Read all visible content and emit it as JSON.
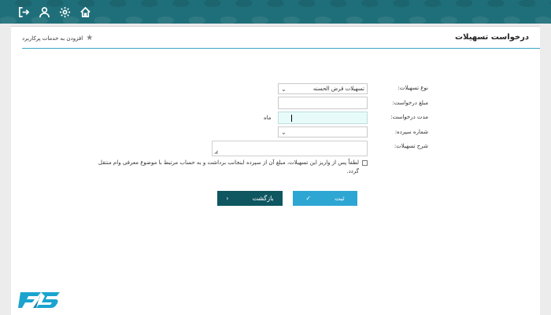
{
  "header": {
    "icons": [
      "home-icon",
      "gear-icon",
      "user-icon",
      "logout-icon"
    ]
  },
  "page": {
    "title": "درخواست تسهیلات",
    "add_to_services": "افزودن به خدمات پرکاربرد"
  },
  "form": {
    "loan_type": {
      "label": "نوع تسهیلات:",
      "value": "تسهیلات قرض الحسنه"
    },
    "amount": {
      "label": "مبلغ درخواست:",
      "value": ""
    },
    "duration": {
      "label": "مدت درخواست:",
      "value": "",
      "unit": "ماه"
    },
    "deposit_number": {
      "label": "شماره سپرده:",
      "value": ""
    },
    "description": {
      "label": "شرح تسهیلات:",
      "value": ""
    },
    "agreement": {
      "checked": false,
      "text_line1": "لطفاً پس از واریز این تسهیلات، مبلغ آن از سپرده اینجانب برداشت و به حساب مرتبط با موضوع معرفی وام منتقل",
      "text_line2": "گردد."
    }
  },
  "buttons": {
    "submit": "ثبت",
    "back": "بازگشت"
  },
  "colors": {
    "header": "#1f6f7a",
    "accent": "#3aa6c6",
    "submit": "#2ea6d3",
    "back": "#0e5660"
  }
}
